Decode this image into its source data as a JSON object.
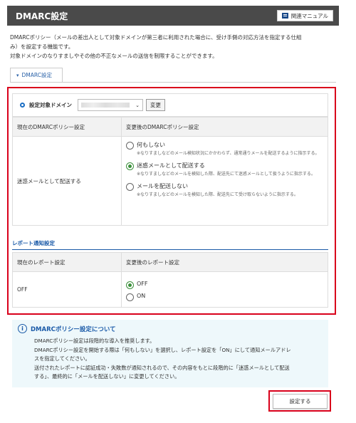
{
  "header": {
    "title": "DMARC設定",
    "manual_label": "関連マニュアル"
  },
  "description": {
    "line1": "DMARCポリシー（メールの差出人として対象ドメインが第三者に利用された場合に、受け手側の対応方法を指定する仕組",
    "line2": "み）を設定する機能です。",
    "line3": "対象ドメインのなりすましやその他の不正なメールの送信を制限することができます。"
  },
  "tab": {
    "label": "DMARC設定"
  },
  "domain": {
    "label": "設定対象ドメイン",
    "change_label": "変更"
  },
  "policy_table": {
    "headers": [
      "現在のDMARCポリシー設定",
      "変更後のDMARCポリシー設定"
    ],
    "current": "迷惑メールとして配送する",
    "options": [
      {
        "label": "何もしない",
        "note": "※なりすましなどのメール検知状況にかかわらず、通常通りメールを配送するように指示する。",
        "selected": false
      },
      {
        "label": "迷惑メールとして配送する",
        "note": "※なりすましなどのメールを検知した際、配送先にて迷惑メールとして扱うように指示する。",
        "selected": true
      },
      {
        "label": "メールを配送しない",
        "note": "※なりすましなどのメールを検知した際、配送先にて受け取らないように指示する。",
        "selected": false
      }
    ]
  },
  "report": {
    "title": "レポート通知設定",
    "headers": [
      "現在のレポート設定",
      "変更後のレポート設定"
    ],
    "current": "OFF",
    "options": [
      {
        "label": "OFF",
        "selected": true
      },
      {
        "label": "ON",
        "selected": false
      }
    ]
  },
  "info": {
    "title": "DMARCポリシー設定について",
    "line1": "DMARCポリシー設定は段階的な導入を推奨します。",
    "line2": "DMARCポリシー設定を開始する際は「何もしない」を選択し、レポート設定を「ON」にして通知メールアドレ",
    "line3": "スを指定してください。",
    "line4": "送付されたレポートに認証成功・失敗数が通知されるので、その内容をもとに段階的に「迷惑メールとして配送",
    "line5": "する」、最終的に「メールを配送しない」に変更してください。"
  },
  "submit_label": "設定する",
  "colors": {
    "accent": "#1a5aa8",
    "highlight": "#d9001b",
    "header_bg": "#4a4a4a"
  }
}
